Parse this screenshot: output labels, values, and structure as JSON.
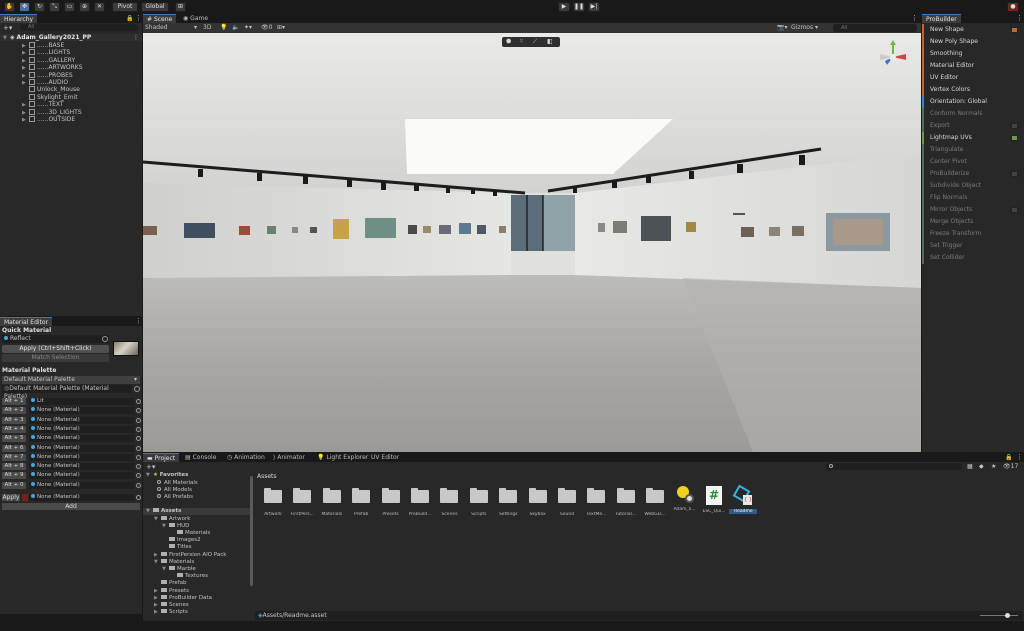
{
  "toolbar": {
    "pivot_label": "Pivot",
    "global_label": "Global"
  },
  "hierarchy": {
    "tab_label": "Hierarchy",
    "search_placeholder": "All",
    "scene_name": "Adam_Gallery2021_PP",
    "items": [
      {
        "label": "......BASE",
        "expandable": true
      },
      {
        "label": "......LIGHTS",
        "expandable": true
      },
      {
        "label": "......GALLERY",
        "expandable": true
      },
      {
        "label": "......ARTWORKS",
        "expandable": true
      },
      {
        "label": "......PROBES",
        "expandable": true
      },
      {
        "label": "......AUDIO",
        "expandable": true
      },
      {
        "label": "Unlock_Mouse",
        "expandable": false
      },
      {
        "label": "Skylight_Emit",
        "expandable": false
      },
      {
        "label": "......TEXT",
        "expandable": true
      },
      {
        "label": "......3D_LIGHTS",
        "expandable": true
      },
      {
        "label": "......OUTSIDE",
        "expandable": true
      }
    ]
  },
  "scene_view": {
    "tabs": [
      "Scene",
      "Game"
    ],
    "shading_mode": "Shaded",
    "mode_2d3d": "3D",
    "fx_count": "0",
    "gizmos_label": "Gizmos",
    "search_placeholder": "All"
  },
  "material_editor": {
    "tab_label": "Material Editor",
    "quick_material_heading": "Quick Material",
    "quick_material_value": "Reflect",
    "apply_label": "Apply (Ctrl+Shift+Click)",
    "match_selection_label": "Match Selection",
    "palette_heading": "Material Palette",
    "palette_select": "Default Material Palette",
    "palette_field": "Default Material Palette (Material Palette)",
    "slots": [
      {
        "key": "Alt + 1",
        "material": "Lit"
      },
      {
        "key": "Alt + 2",
        "material": "None (Material)"
      },
      {
        "key": "Alt + 3",
        "material": "None (Material)"
      },
      {
        "key": "Alt + 4",
        "material": "None (Material)"
      },
      {
        "key": "Alt + 5",
        "material": "None (Material)"
      },
      {
        "key": "Alt + 6",
        "material": "None (Material)"
      },
      {
        "key": "Alt + 7",
        "material": "None (Material)"
      },
      {
        "key": "Alt + 8",
        "material": "None (Material)"
      },
      {
        "key": "Alt + 9",
        "material": "None (Material)"
      },
      {
        "key": "Alt + 0",
        "material": "None (Material)"
      }
    ],
    "apply_slot_label": "Apply",
    "apply_slot_material": "None (Material)",
    "add_label": "Add"
  },
  "probuilder": {
    "tab_label": "ProBuilder",
    "items": [
      {
        "label": "New Shape",
        "style": "orange",
        "option": true
      },
      {
        "label": "New Poly Shape",
        "style": "orange",
        "option": false
      },
      {
        "label": "Smoothing",
        "style": "orange",
        "option": false
      },
      {
        "label": "Material Editor",
        "style": "orange",
        "option": false
      },
      {
        "label": "UV Editor",
        "style": "orange",
        "option": false
      },
      {
        "label": "Vertex Colors",
        "style": "orange",
        "option": false
      },
      {
        "label": "Orientation: Global",
        "style": "blue",
        "option": false
      },
      {
        "label": "Conform Normals",
        "style": "dim",
        "option": false
      },
      {
        "label": "Export",
        "style": "dim",
        "option": true
      },
      {
        "label": "Lightmap UVs",
        "style": "green",
        "option": true
      },
      {
        "label": "Triangulate",
        "style": "dim",
        "option": false
      },
      {
        "label": "Center Pivot",
        "style": "dim",
        "option": false
      },
      {
        "label": "ProBuilderize",
        "style": "dim",
        "option": true
      },
      {
        "label": "Subdivide Object",
        "style": "dim",
        "option": false
      },
      {
        "label": "Flip Normals",
        "style": "dim",
        "option": false
      },
      {
        "label": "Mirror Objects",
        "style": "dim",
        "option": true
      },
      {
        "label": "Merge Objects",
        "style": "dim",
        "option": false
      },
      {
        "label": "Freeze Transform",
        "style": "dim",
        "option": false
      },
      {
        "label": "Set Trigger",
        "style": "dim",
        "option": false
      },
      {
        "label": "Set Collider",
        "style": "dim",
        "option": false
      }
    ]
  },
  "project": {
    "tabs": [
      "Project",
      "Console",
      "Animation",
      "Animator",
      "Light Explorer",
      "UV Editor"
    ],
    "hidden_count": "17",
    "favorites_label": "Favorites",
    "favorites": [
      "All Materials",
      "All Models",
      "All Prefabs"
    ],
    "assets_label": "Assets",
    "tree": [
      {
        "label": "Artwork",
        "depth": 1,
        "arrow": "open"
      },
      {
        "label": "HUD",
        "depth": 2,
        "arrow": "open"
      },
      {
        "label": "Materials",
        "depth": 3,
        "arrow": "none"
      },
      {
        "label": "Images2",
        "depth": 2,
        "arrow": "none"
      },
      {
        "label": "Titles",
        "depth": 2,
        "arrow": "none"
      },
      {
        "label": "FirstPersion AIO Pack",
        "depth": 1,
        "arrow": "closed"
      },
      {
        "label": "Materials",
        "depth": 1,
        "arrow": "open"
      },
      {
        "label": "Marble",
        "depth": 2,
        "arrow": "open"
      },
      {
        "label": "Textures",
        "depth": 3,
        "arrow": "none"
      },
      {
        "label": "Prefab",
        "depth": 1,
        "arrow": "none"
      },
      {
        "label": "Presets",
        "depth": 1,
        "arrow": "closed"
      },
      {
        "label": "ProBuilder Data",
        "depth": 1,
        "arrow": "closed"
      },
      {
        "label": "Scenes",
        "depth": 1,
        "arrow": "closed"
      },
      {
        "label": "Scripts",
        "depth": 1,
        "arrow": "closed"
      }
    ],
    "breadcrumb": "Assets",
    "items": [
      {
        "label": "Artwork",
        "kind": "folder"
      },
      {
        "label": "FirstPers...",
        "kind": "folder"
      },
      {
        "label": "Materials",
        "kind": "folder"
      },
      {
        "label": "Prefab",
        "kind": "folder"
      },
      {
        "label": "Presets",
        "kind": "folder"
      },
      {
        "label": "ProBuild...",
        "kind": "folder"
      },
      {
        "label": "Scenes",
        "kind": "folder"
      },
      {
        "label": "Scripts",
        "kind": "folder"
      },
      {
        "label": "Settings",
        "kind": "folder"
      },
      {
        "label": "Skybox",
        "kind": "folder"
      },
      {
        "label": "Sound",
        "kind": "folder"
      },
      {
        "label": "TextMe...",
        "kind": "folder"
      },
      {
        "label": "Tutorial...",
        "kind": "folder"
      },
      {
        "label": "WebGLT...",
        "kind": "folder"
      },
      {
        "label": "Adam_li...",
        "kind": "lighting"
      },
      {
        "label": "ESC_Qui...",
        "kind": "script"
      },
      {
        "label": "Readme",
        "kind": "readme"
      }
    ],
    "status_path": "Assets/Readme.asset"
  }
}
